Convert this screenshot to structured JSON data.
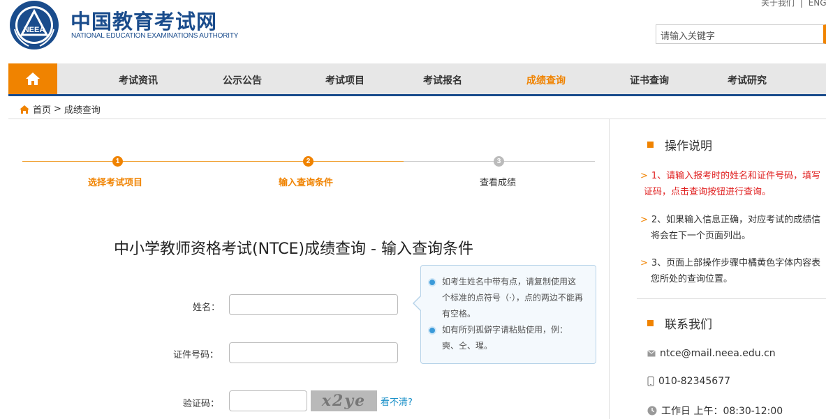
{
  "header": {
    "logo_cn": "中国教育考试网",
    "logo_en": "NATIONAL EDUCATION EXAMINATIONS AUTHORITY",
    "emblem_text": "NEEA",
    "top_links": [
      "关于我们",
      "|",
      "ENG"
    ],
    "search_placeholder": "请输入关键字"
  },
  "nav": {
    "items": [
      {
        "label": "考试资讯"
      },
      {
        "label": "公示公告"
      },
      {
        "label": "考试项目"
      },
      {
        "label": "考试报名"
      },
      {
        "label": "成绩查询"
      },
      {
        "label": "证书查询"
      },
      {
        "label": "考试研究"
      }
    ],
    "active": "成绩查询"
  },
  "breadcrumb": {
    "home": "首页",
    "sep": ">",
    "current": "成绩查询"
  },
  "steps": [
    {
      "num": "1",
      "label": "选择考试项目"
    },
    {
      "num": "2",
      "label": "输入查询条件"
    },
    {
      "num": "3",
      "label": "查看成绩"
    }
  ],
  "form": {
    "title": "中小学教师资格考试(NTCE)成绩查询 - 输入查询条件",
    "name_label": "姓名：",
    "id_label": "证件号码：",
    "captcha_label": "验证码：",
    "captcha_text": "x2ye",
    "refresh_label": "看不清?",
    "tips": [
      "如考生姓名中带有点，请复制使用这个标准的点符号（·），点的两边不能再有空格。",
      "如有所列孤僻字请粘贴使用，例：奭、仝、瑆。"
    ]
  },
  "sidebar": {
    "instructions_title": "操作说明",
    "instructions": [
      {
        "line1": "1、请输入报考时的姓名和证件号码，填写",
        "line2": "证码，点击查询按钮进行查询。"
      },
      {
        "line1": "2、如果输入信息正确，对应考试的成绩信",
        "line2": "将会在下一个页面列出。"
      },
      {
        "line1": "3、页面上部操作步骤中橘黄色字体内容表",
        "line2": "您所处的查询位置。"
      }
    ],
    "contact_title": "联系我们",
    "email": "ntce@mail.neea.edu.cn",
    "phone": "010-82345677",
    "hours": "工作日 上午：08:30-12:00"
  },
  "colors": {
    "brand_blue": "#1a4c8c",
    "accent_orange": "#f08300",
    "instruction_red": "#e02020"
  }
}
